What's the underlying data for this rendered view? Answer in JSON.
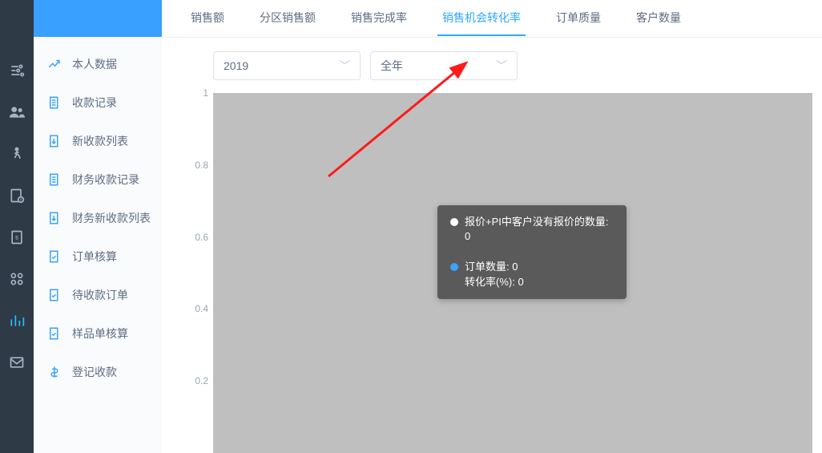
{
  "rail": {
    "items": [
      {
        "name": "sliders-icon"
      },
      {
        "name": "users-icon"
      },
      {
        "name": "person-icon"
      },
      {
        "name": "document-money-icon"
      },
      {
        "name": "invoice-icon"
      },
      {
        "name": "grid-icon"
      },
      {
        "name": "bar-chart-icon",
        "active": true
      },
      {
        "name": "mail-icon"
      }
    ]
  },
  "sidebar": {
    "items": [
      {
        "icon": "trend-up-icon",
        "label": "本人数据"
      },
      {
        "icon": "receipt-icon",
        "label": "收款记录"
      },
      {
        "icon": "list-down-icon",
        "label": "新收款列表"
      },
      {
        "icon": "receipt-icon",
        "label": "财务收款记录"
      },
      {
        "icon": "list-down-icon",
        "label": "财务新收款列表"
      },
      {
        "icon": "doc-check-icon",
        "label": "订单核算"
      },
      {
        "icon": "doc-check-icon",
        "label": "待收款订单"
      },
      {
        "icon": "doc-check-icon",
        "label": "样品单核算"
      },
      {
        "icon": "dollar-icon",
        "label": "登记收款"
      }
    ]
  },
  "tabs": [
    {
      "label": "销售额"
    },
    {
      "label": "分区销售额"
    },
    {
      "label": "销售完成率"
    },
    {
      "label": "销售机会转化率",
      "active": true
    },
    {
      "label": "订单质量"
    },
    {
      "label": "客户数量"
    }
  ],
  "filters": {
    "year": "2019",
    "period": "全年"
  },
  "tooltip": {
    "line1_label": "报价+PI中客户没有报价的数量:",
    "line1_value": "0",
    "line2a_label": "订单数量:",
    "line2a_value": "0",
    "line2b_label": "转化率(%):",
    "line2b_value": "0"
  },
  "chart_data": {
    "type": "line",
    "title": "",
    "xlabel": "",
    "ylabel": "",
    "ylim": [
      0,
      1
    ],
    "yticks": [
      1,
      0.8,
      0.6,
      0.4,
      0.2
    ],
    "series": [
      {
        "name": "报价+PI中客户没有报价的数量",
        "values": [
          0
        ]
      },
      {
        "name": "订单数量",
        "values": [
          0
        ]
      },
      {
        "name": "转化率(%)",
        "values": [
          0
        ]
      }
    ]
  }
}
